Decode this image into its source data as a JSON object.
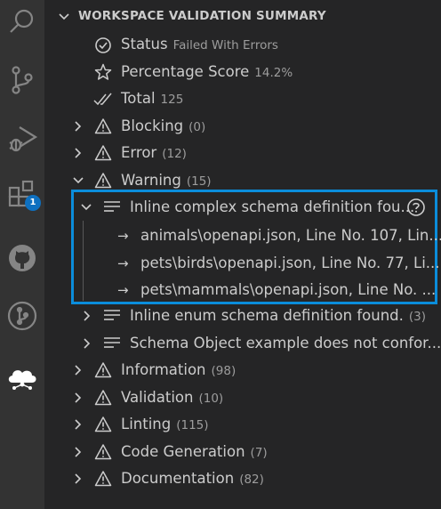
{
  "activity_bar": {
    "items": [
      {
        "name": "search-icon"
      },
      {
        "name": "source-control-icon"
      },
      {
        "name": "run-debug-icon"
      },
      {
        "name": "extensions-icon",
        "badge": "1"
      },
      {
        "name": "github-icon"
      },
      {
        "name": "git-pull-request-icon"
      },
      {
        "name": "cloud-network-icon"
      }
    ]
  },
  "panel": {
    "title": "WORKSPACE VALIDATION SUMMARY",
    "summary": {
      "status_label": "Status",
      "status_value": "Failed With Errors",
      "score_label": "Percentage Score",
      "score_value": "14.2%",
      "total_label": "Total",
      "total_value": "125"
    },
    "categories": [
      {
        "label": "Blocking",
        "count": "(0)"
      },
      {
        "label": "Error",
        "count": "(12)"
      },
      {
        "label": "Warning",
        "count": "(15)"
      }
    ],
    "warning_groups": [
      {
        "label": "Inline complex schema definition fou...",
        "count": ""
      },
      {
        "label": "Inline enum schema definition found.",
        "count": "(3)"
      },
      {
        "label": "Schema Object example does not confor...",
        "count": ""
      }
    ],
    "locations": [
      "animals\\openapi.json, Line No. 107, Lin...",
      "pets\\birds\\openapi.json, Line No. 77, Li...",
      "pets\\mammals\\openapi.json, Line No. ..."
    ],
    "more_categories": [
      {
        "label": "Information",
        "count": "(98)"
      },
      {
        "label": "Validation",
        "count": "(10)"
      },
      {
        "label": "Linting",
        "count": "(115)"
      },
      {
        "label": "Code Generation",
        "count": "(7)"
      },
      {
        "label": "Documentation",
        "count": "(82)"
      }
    ]
  },
  "colors": {
    "background": "#252526",
    "activity_bar": "#333333",
    "highlight_border": "#0b8ddb",
    "badge": "#0e70c0"
  }
}
